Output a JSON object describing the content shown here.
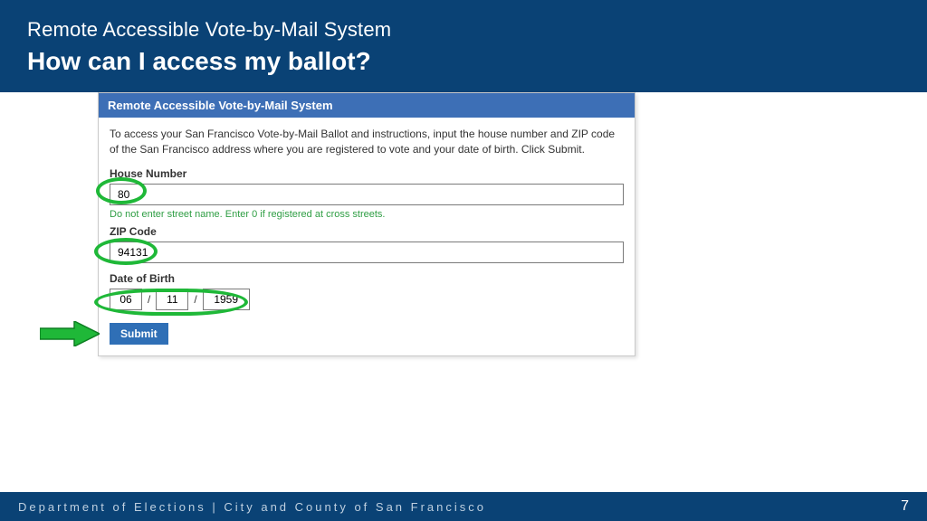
{
  "header": {
    "eyebrow": "Remote Accessible Vote-by-Mail System",
    "title": "How can I access my ballot?"
  },
  "form": {
    "card_title": "Remote Accessible Vote-by-Mail System",
    "intro": "To access your San Francisco Vote-by-Mail Ballot and instructions, input the house number and ZIP code of the San Francisco address where you are registered to vote and your date of birth. Click Submit.",
    "house_label": "House Number",
    "house_value": "80",
    "house_hint": "Do not enter street name. Enter 0 if registered at cross streets.",
    "zip_label": "ZIP Code",
    "zip_value": "94131",
    "dob_label": "Date of Birth",
    "dob_mm": "06",
    "dob_dd": "11",
    "dob_yyyy": "1959",
    "dob_sep": "/",
    "submit_label": "Submit"
  },
  "footer": {
    "org": "Department of Elections | City and County of San Francisco",
    "page": "7"
  }
}
